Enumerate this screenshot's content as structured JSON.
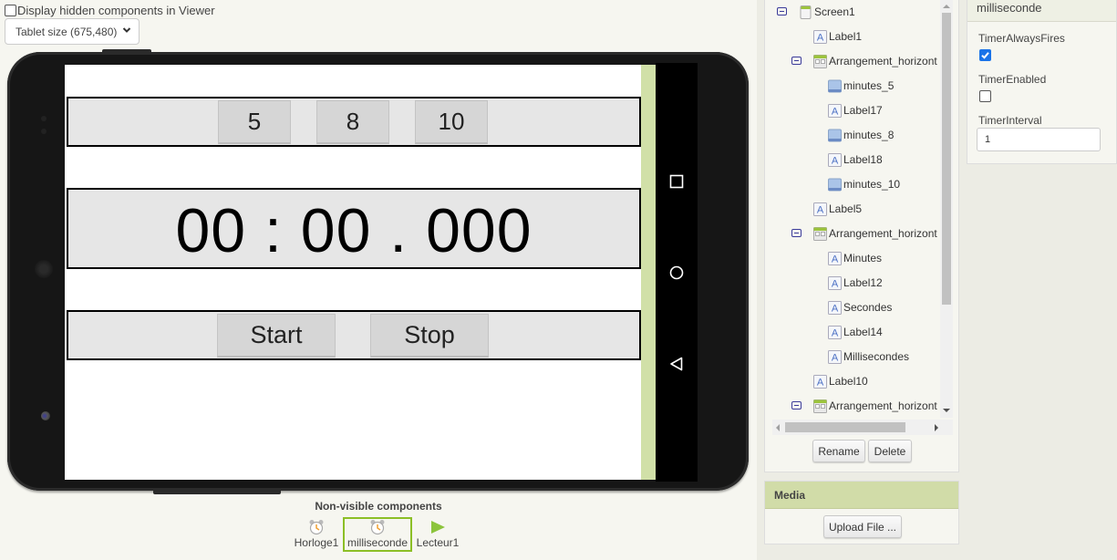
{
  "viewer": {
    "hidden_toggle_label": "Display hidden components in Viewer",
    "hidden_toggle_checked": false,
    "size_select_value": "Tablet size (675,480)"
  },
  "app_screen": {
    "minute_buttons": [
      "5",
      "8",
      "10"
    ],
    "time_display": "00 : 00 . 000",
    "start_label": "Start",
    "stop_label": "Stop",
    "strip_color": "#d1e0a8"
  },
  "non_visible": {
    "title": "Non-visible components",
    "items": [
      {
        "name": "Horloge1",
        "icon": "clock-icon"
      },
      {
        "name": "milliseconde",
        "icon": "clock-icon",
        "selected": true
      },
      {
        "name": "Lecteur1",
        "icon": "play-icon"
      }
    ]
  },
  "components": {
    "tree": [
      {
        "label": "Screen1",
        "icon": "screen-icon",
        "level": 0,
        "collapsible": true
      },
      {
        "label": "Label1",
        "icon": "label-icon",
        "level": 1
      },
      {
        "label": "Arrangement_horizont",
        "icon": "arrangement-icon",
        "level": 1,
        "collapsible": true
      },
      {
        "label": "minutes_5",
        "icon": "button-icon",
        "level": 2
      },
      {
        "label": "Label17",
        "icon": "label-icon",
        "level": 2
      },
      {
        "label": "minutes_8",
        "icon": "button-icon",
        "level": 2
      },
      {
        "label": "Label18",
        "icon": "label-icon",
        "level": 2
      },
      {
        "label": "minutes_10",
        "icon": "button-icon",
        "level": 2
      },
      {
        "label": "Label5",
        "icon": "label-icon",
        "level": 1
      },
      {
        "label": "Arrangement_horizont",
        "icon": "arrangement-icon",
        "level": 1,
        "collapsible": true
      },
      {
        "label": "Minutes",
        "icon": "label-icon",
        "level": 2
      },
      {
        "label": "Label12",
        "icon": "label-icon",
        "level": 2
      },
      {
        "label": "Secondes",
        "icon": "label-icon",
        "level": 2
      },
      {
        "label": "Label14",
        "icon": "label-icon",
        "level": 2
      },
      {
        "label": "Millisecondes",
        "icon": "label-icon",
        "level": 2
      },
      {
        "label": "Label10",
        "icon": "label-icon",
        "level": 1
      },
      {
        "label": "Arrangement_horizont",
        "icon": "arrangement-icon",
        "level": 1,
        "collapsible": true
      }
    ],
    "rename_label": "Rename",
    "delete_label": "Delete"
  },
  "media": {
    "title": "Media",
    "upload_label": "Upload File ..."
  },
  "properties": {
    "component_name": "milliseconde",
    "timer_always_fires_label": "TimerAlwaysFires",
    "timer_always_fires": true,
    "timer_enabled_label": "TimerEnabled",
    "timer_enabled": false,
    "timer_interval_label": "TimerInterval",
    "timer_interval": "1"
  }
}
